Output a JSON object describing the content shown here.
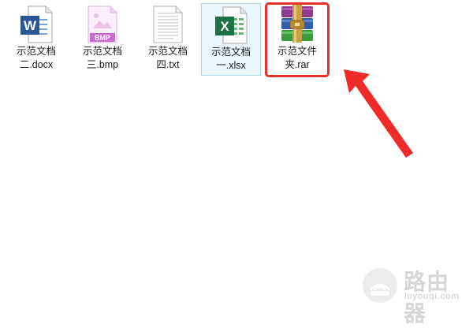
{
  "files": [
    {
      "id": "docx",
      "name": "示范文档\n二.docx",
      "icon": "word-document-icon"
    },
    {
      "id": "bmp",
      "name": "示范文档\n三.bmp",
      "icon": "bmp-image-icon",
      "badge": "BMP"
    },
    {
      "id": "txt",
      "name": "示范文档\n四.txt",
      "icon": "text-document-icon"
    },
    {
      "id": "xlsx",
      "name": "示范文档\n一.xlsx",
      "icon": "excel-spreadsheet-icon",
      "selected": true
    },
    {
      "id": "rar",
      "name": "示范文件\n夹.rar",
      "icon": "winrar-archive-icon",
      "highlighted": true
    }
  ],
  "icon_letters": {
    "word": "W",
    "excel": "X"
  },
  "annotation": {
    "highlight_color": "#e8302d",
    "arrow_color": "#e8302d"
  },
  "watermark": {
    "title": "路由器",
    "url": "luyouqi.com"
  }
}
